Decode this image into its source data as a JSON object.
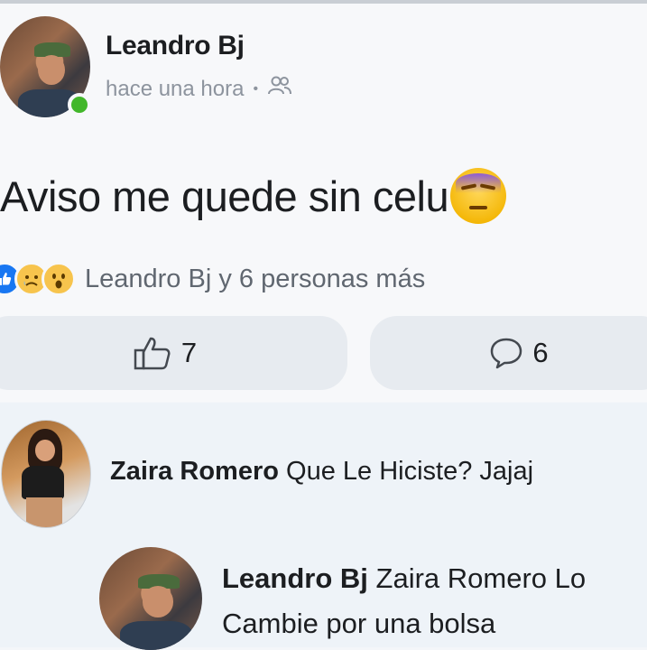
{
  "post": {
    "author": "Leandro Bj",
    "time": "hace una hora",
    "privacy_icon": "friends-icon",
    "text": "Aviso me quede sin celu",
    "emoji": "weary-face-emoji",
    "reactions": {
      "icons": [
        "like-reaction",
        "sad-reaction",
        "wow-reaction"
      ],
      "summary": "Leandro Bj y 6 personas más"
    },
    "like_count": "7",
    "comment_count": "6"
  },
  "comments": [
    {
      "author": "Zaira Romero",
      "text": "Que Le Hiciste? Jajaj"
    },
    {
      "author": "Leandro Bj",
      "text_line1": "Zaira Romero Lo",
      "text_line2": "Cambie por una bolsa"
    }
  ],
  "colors": {
    "online": "#42b72a",
    "like_blue": "#1877f2",
    "button_bg": "#e7ebf0",
    "muted_text": "#8d949e"
  }
}
